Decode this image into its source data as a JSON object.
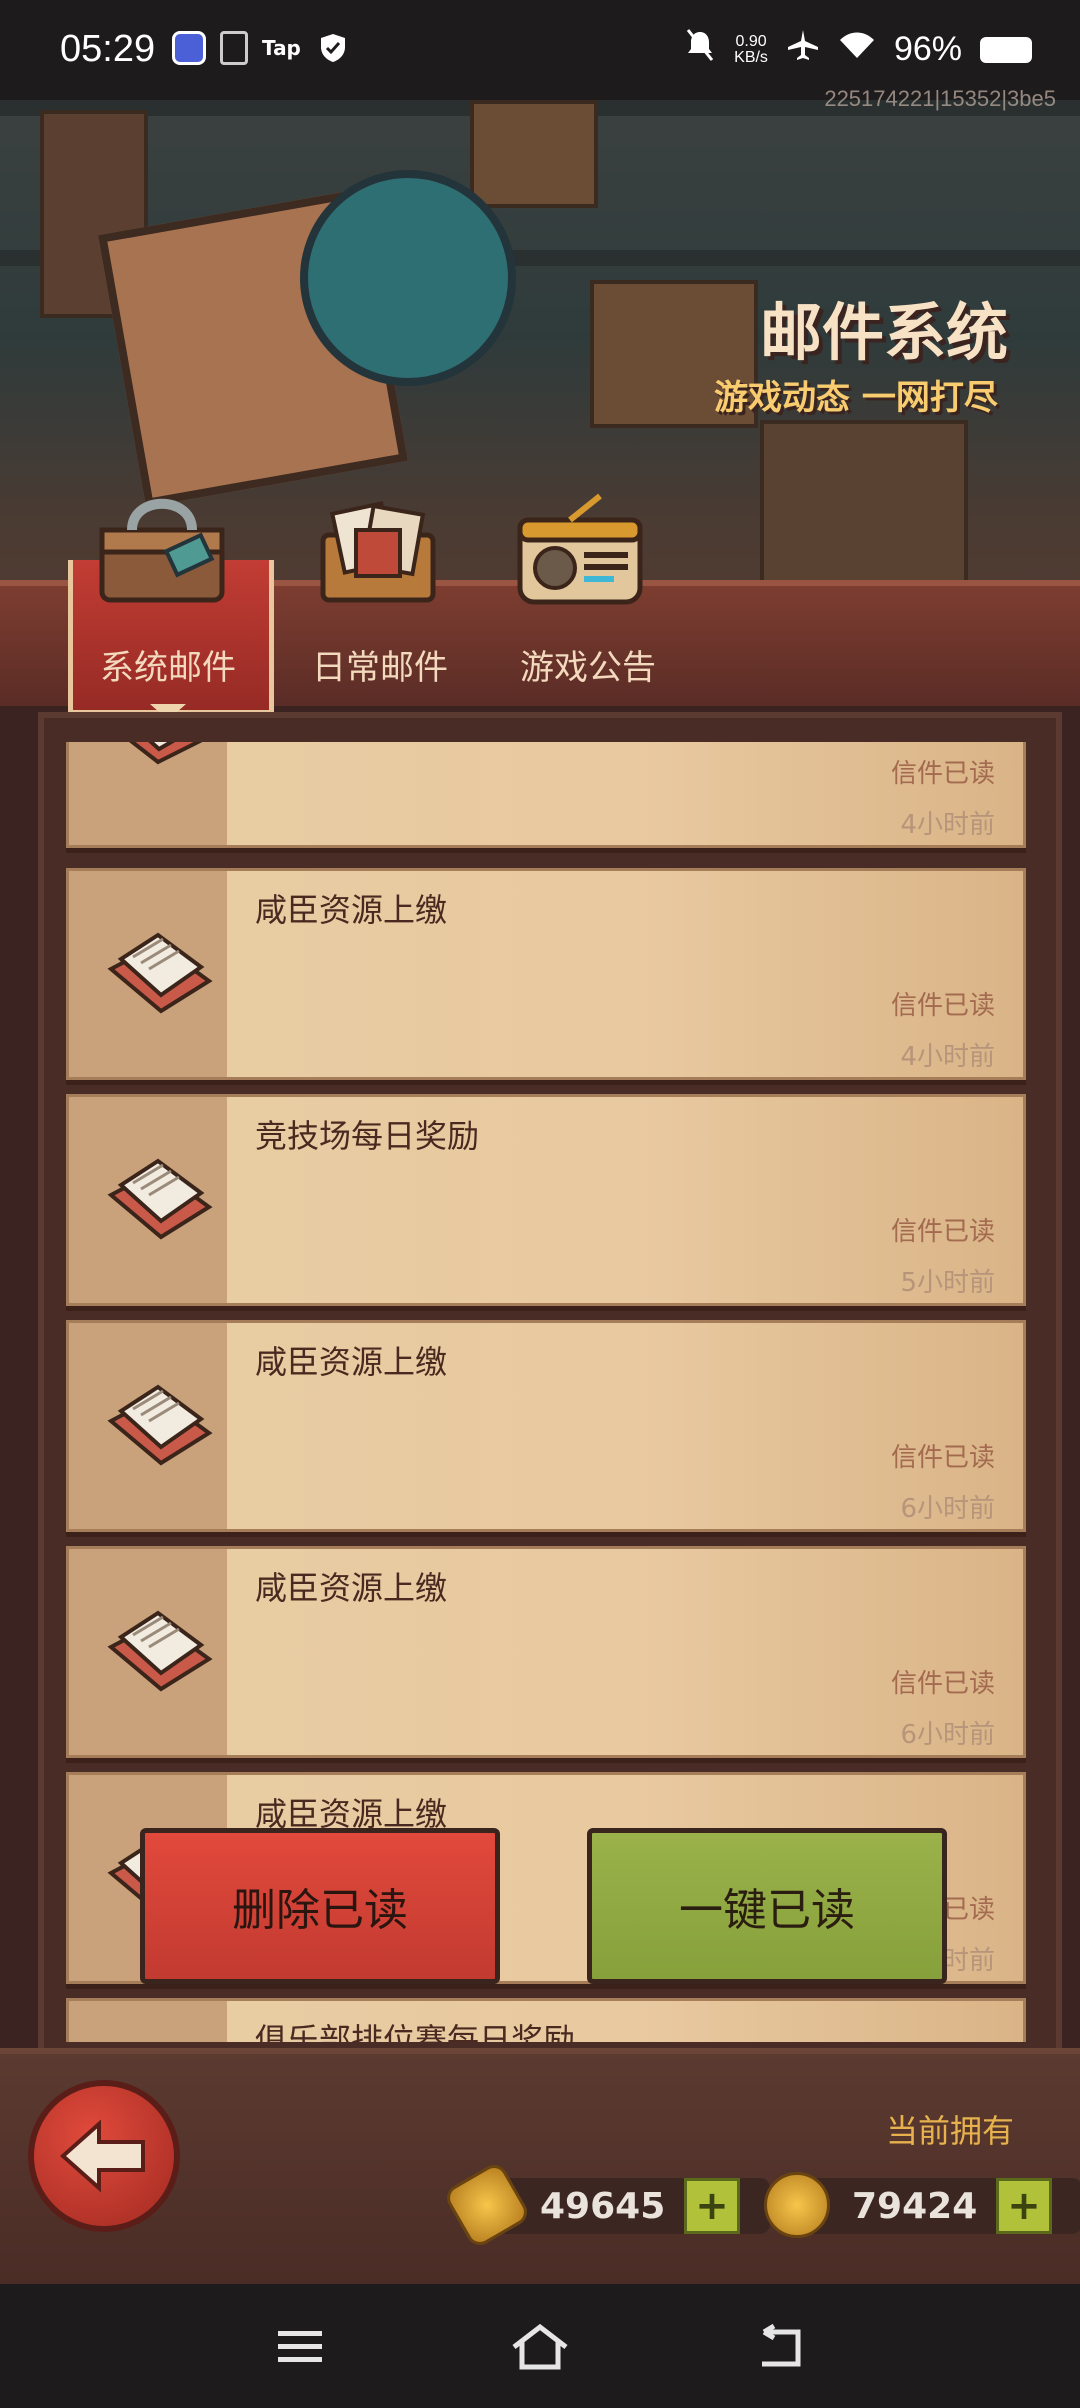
{
  "status_bar": {
    "time": "05:29",
    "net_speed_value": "0.90",
    "net_speed_unit": "KB/s",
    "battery": "96%",
    "left_icons": [
      "app-icon",
      "document-icon",
      "taptap-icon",
      "shield-check-icon"
    ],
    "taptap_label": "Tap",
    "right_icons": [
      "mute-bell-icon",
      "airplane-icon",
      "wifi-icon",
      "battery-icon"
    ]
  },
  "build_id": "225174221|15352|3be5",
  "banner": {
    "title": "邮件系统",
    "subtitle": "游戏动态 一网打尽"
  },
  "tabs": [
    {
      "label": "系统邮件",
      "active": true,
      "icon": "treasure-chest-icon"
    },
    {
      "label": "日常邮件",
      "active": false,
      "icon": "letters-box-icon"
    },
    {
      "label": "游戏公告",
      "active": false,
      "icon": "radio-icon"
    }
  ],
  "mails": [
    {
      "subject": "",
      "status": "信件已读",
      "time": "4小时前"
    },
    {
      "subject": "咸臣资源上缴",
      "status": "信件已读",
      "time": "4小时前"
    },
    {
      "subject": "竞技场每日奖励",
      "status": "信件已读",
      "time": "5小时前"
    },
    {
      "subject": "咸臣资源上缴",
      "status": "信件已读",
      "time": "6小时前"
    },
    {
      "subject": "咸臣资源上缴",
      "status": "信件已读",
      "time": "6小时前"
    },
    {
      "subject": "咸臣资源上缴",
      "status": "信件已读",
      "time": "时前"
    },
    {
      "subject": "俱乐部排位赛每日奖励",
      "status": "",
      "time": ""
    }
  ],
  "actions": {
    "delete_read": "删除已读",
    "mark_all_read": "一键已读"
  },
  "bottom": {
    "currency_label": "当前拥有",
    "gold_bar_amount": "49645",
    "coin_amount": "79424",
    "back_icon": "back-arrow-icon"
  },
  "navbar": {
    "icons": [
      "menu-icon",
      "home-icon",
      "back-icon"
    ]
  }
}
